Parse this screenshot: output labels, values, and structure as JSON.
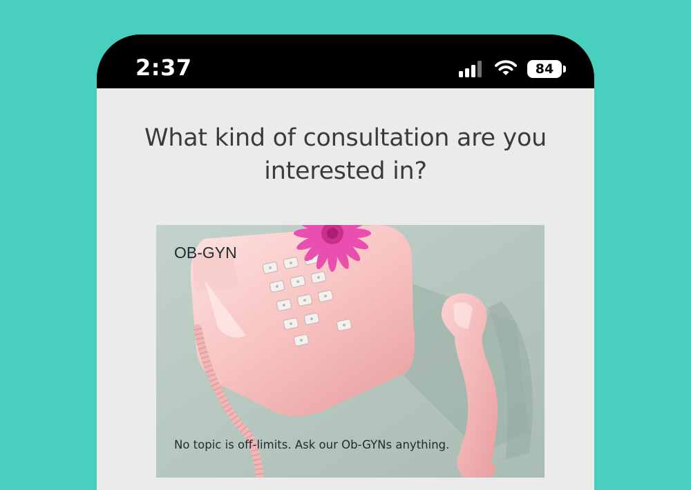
{
  "status_bar": {
    "time": "2:37",
    "battery_level": "84",
    "signal_icon": "cellular-signal-icon",
    "wifi_icon": "wifi-icon"
  },
  "question": {
    "title": "What kind of consultation are you interested in?"
  },
  "options": [
    {
      "title": "OB-GYN",
      "description": "No topic is off-limits. Ask our Ob-GYNs anything.",
      "image": "pink-rotary-telephone-with-pink-flower"
    }
  ],
  "colors": {
    "background": "#48cfbe",
    "screen": "#ebebeb",
    "status_bar": "#000000",
    "text": "#3b3b3b"
  }
}
